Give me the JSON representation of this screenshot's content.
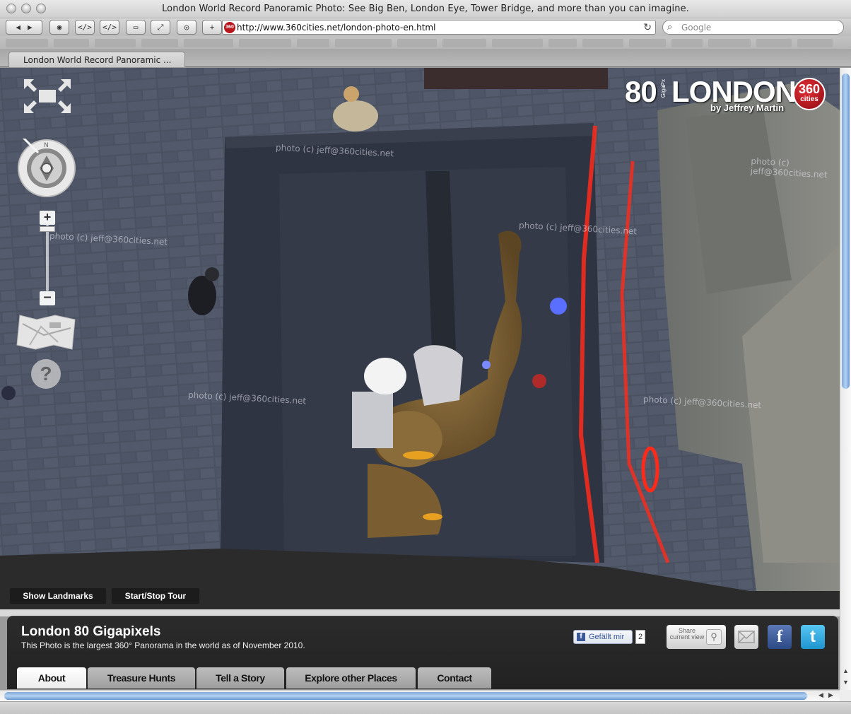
{
  "window": {
    "title": "London World Record Panoramic Photo: See Big Ben, London Eye, Tower Bridge, and more than you can imagine."
  },
  "toolbar": {
    "back_icon": "back-arrow-icon",
    "forward_icon": "forward-arrow-icon",
    "url": "http://www.360cities.net/london-photo-en.html",
    "site_badge": "360",
    "search_placeholder": "Google"
  },
  "tab": {
    "label": "London World Record Panoramic ..."
  },
  "branding": {
    "number": "80",
    "unit": "GigaPx",
    "city": "LONDON",
    "byline": "by Jeffrey Martin",
    "badge_number": "360",
    "badge_word": "cities"
  },
  "watermark": "photo (c) jeff@360cities.net",
  "viewer_buttons": {
    "show_landmarks": "Show Landmarks",
    "tour": "Start/Stop Tour"
  },
  "controls": {
    "zoom_in": "+",
    "zoom_out": "–",
    "help": "?",
    "compass_north": "N"
  },
  "info": {
    "title": "London 80 Gigapixels",
    "subtitle": "This Photo is the largest 360° Panorama in the world as of November 2010.",
    "like_label": "Gefällt mir",
    "like_count": "2",
    "share_label": "Share current view",
    "facebook_glyph": "f",
    "twitter_glyph": "t"
  },
  "tabs": [
    {
      "label": "About",
      "active": true
    },
    {
      "label": "Treasure Hunts",
      "active": false
    },
    {
      "label": "Tell a Story",
      "active": false
    },
    {
      "label": "Explore other Places",
      "active": false
    },
    {
      "label": "Contact",
      "active": false
    }
  ],
  "colors": {
    "brand_red": "#b8141a",
    "neon_red": "#ff2a1a",
    "panel_dark": "#262626",
    "scroll_blue": "#7ea8d8"
  }
}
